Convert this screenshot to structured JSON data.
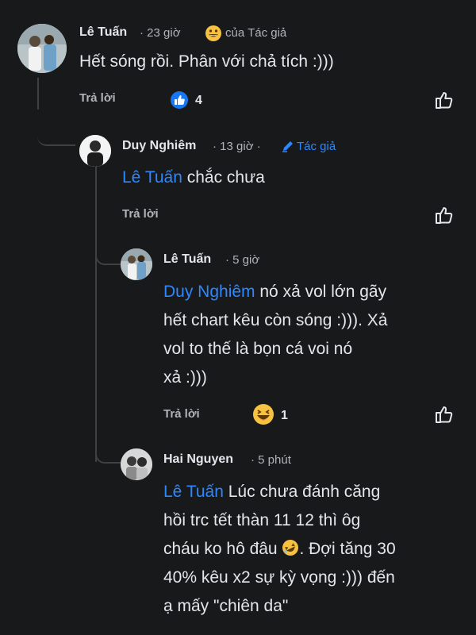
{
  "colors": {
    "background": "#18191a",
    "text": "#e4e6eb",
    "muted": "#b0b3b8",
    "mention": "#2d88ff",
    "like_blue": "#1877f2",
    "emoji": "#f7c142"
  },
  "comments": [
    {
      "author": "Lê Tuấn",
      "time": "· 23 giờ",
      "badge_label": "của Tác giả",
      "badge_icon": "grinning-emoji-icon",
      "text": "Hết sóng rồi. Phân với chả tích :)))",
      "reply_label": "Trả lời",
      "reaction_icon": "like-reaction-icon",
      "reaction_count": "4"
    },
    {
      "author": "Duy Nghiêm",
      "time": "· 13 giờ ·",
      "badge_label": "Tác giả",
      "badge_icon": "pencil-icon",
      "mention": "Lê Tuấn",
      "text": " chắc chưa",
      "reply_label": "Trả lời"
    },
    {
      "author": "Lê Tuấn",
      "time": "· 5 giờ",
      "mention": "Duy Nghiêm",
      "text_line1": " nó xả vol lớn gãy",
      "text_line2": "hết chart kêu còn sóng :))). Xả",
      "text_line3": "vol to thế là bọn cá voi nó",
      "text_line4": "xả :)))",
      "reply_label": "Trả lời",
      "reaction_icon": "haha-reaction-icon",
      "reaction_count": "1"
    },
    {
      "author": "Hai Nguyen",
      "time": "· 5 phút",
      "mention": "Lê Tuấn",
      "text_line1": " Lúc chưa đánh căng",
      "text_line2": "hồi trc tết thàn 11 12 thì ôg",
      "text_line3a": "cháu ko hô đâu ",
      "text_line3b": ". Đợi tăng 30",
      "text_line4": "40% kêu x2 sự kỳ vọng :))) đến",
      "text_line5": "ạ mấy \"chiên da\""
    }
  ]
}
